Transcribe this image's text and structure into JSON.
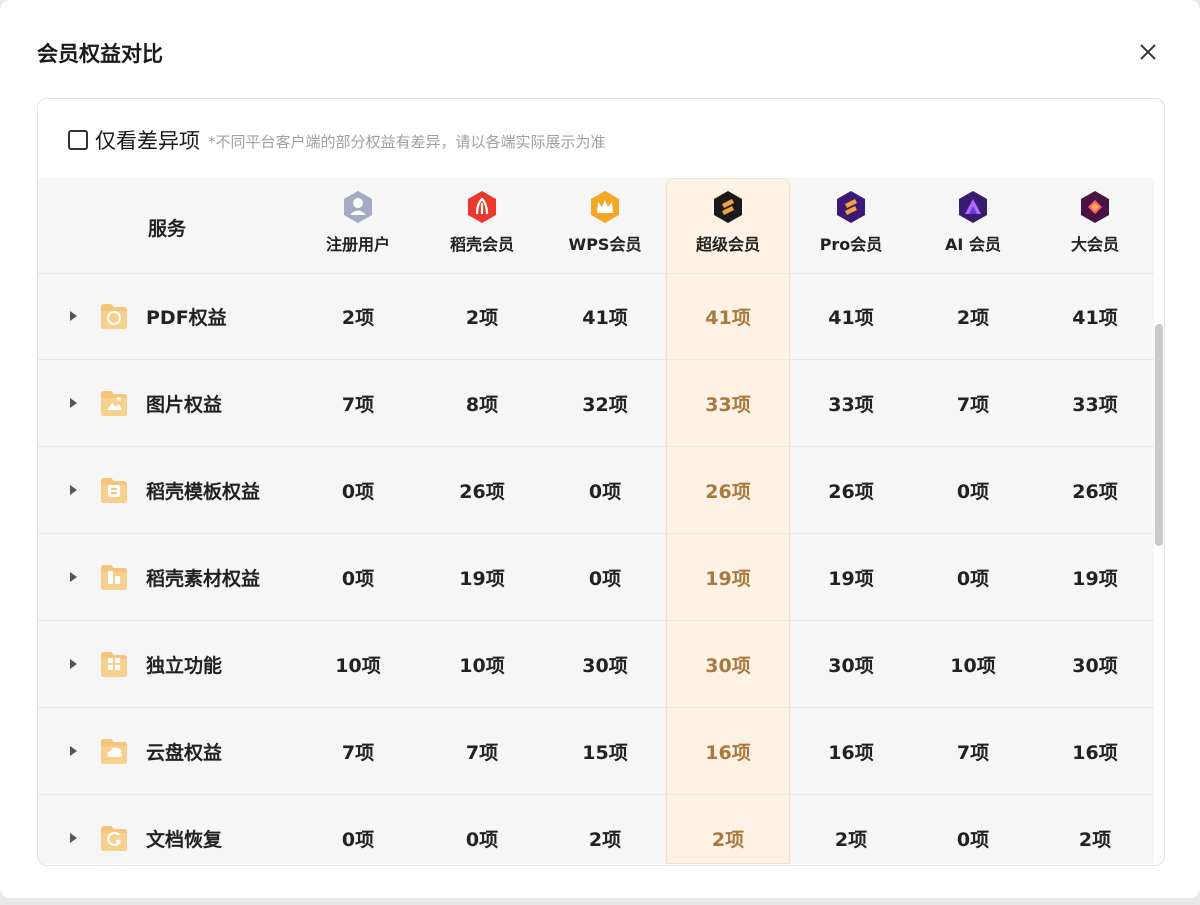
{
  "dialog": {
    "title": "会员权益对比",
    "close_icon": "close-icon"
  },
  "filter": {
    "label": "仅看差异项",
    "note": "*不同平台客户端的部分权益有差异，请以各端实际展示为准",
    "checked": false
  },
  "table": {
    "service_header": "服务",
    "columns": [
      {
        "name": "注册用户",
        "icon": "user-icon",
        "color": "#9ea6bf"
      },
      {
        "name": "稻壳会员",
        "icon": "daoke-icon",
        "color": "#e8392c"
      },
      {
        "name": "WPS会员",
        "icon": "crown-icon",
        "color": "#f5a623"
      },
      {
        "name": "超级会员",
        "icon": "super-icon",
        "color": "#1a1a1a"
      },
      {
        "name": "Pro会员",
        "icon": "pro-icon",
        "color": "#3d1a78"
      },
      {
        "name": "AI 会员",
        "icon": "ai-icon",
        "color": "#3a1c6e"
      },
      {
        "name": "大会员",
        "icon": "big-member-icon",
        "color": "#4a1440"
      }
    ],
    "highlight_color": "#fdf2e4",
    "rows": [
      {
        "label": "PDF权益",
        "icon": "pdf-icon",
        "values": [
          "2项",
          "2项",
          "41项",
          "41项",
          "41项",
          "2项",
          "41项"
        ]
      },
      {
        "label": "图片权益",
        "icon": "image-icon",
        "values": [
          "7项",
          "8项",
          "32项",
          "33项",
          "33项",
          "7项",
          "33项"
        ]
      },
      {
        "label": "稻壳模板权益",
        "icon": "template-icon",
        "values": [
          "0项",
          "26项",
          "0项",
          "26项",
          "26项",
          "0项",
          "26项"
        ]
      },
      {
        "label": "稻壳素材权益",
        "icon": "material-icon",
        "values": [
          "0项",
          "19项",
          "0项",
          "19项",
          "19项",
          "0项",
          "19项"
        ]
      },
      {
        "label": "独立功能",
        "icon": "apps-icon",
        "values": [
          "10项",
          "10项",
          "30项",
          "30项",
          "30项",
          "10项",
          "30项"
        ]
      },
      {
        "label": "云盘权益",
        "icon": "cloud-icon",
        "values": [
          "7项",
          "7项",
          "15项",
          "16项",
          "16项",
          "7项",
          "16项"
        ]
      },
      {
        "label": "文档恢复",
        "icon": "restore-icon",
        "values": [
          "0项",
          "0项",
          "2项",
          "2项",
          "2项",
          "0项",
          "2项"
        ]
      }
    ]
  }
}
